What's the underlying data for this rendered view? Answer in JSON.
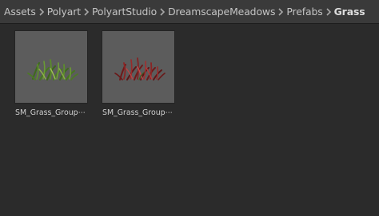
{
  "breadcrumb": {
    "items": [
      "Assets",
      "Polyart",
      "PolyartStudio",
      "DreamscapeMeadows",
      "Prefabs"
    ],
    "current": "Grass",
    "separator_icon": "chevron-right-icon"
  },
  "assets": [
    {
      "label": "SM_Grass_Group⋯",
      "thumbnail_icon": "green-grass-clump-icon",
      "color": "#4f7a2a"
    },
    {
      "label": "SM_Grass_Group⋯",
      "thumbnail_icon": "red-grass-clump-icon",
      "color": "#7a1f1f"
    }
  ],
  "colors": {
    "panel_background": "#2b2b2b",
    "breadcrumb_background": "#3a3a3a",
    "thumbnail_background": "#5c5c5c"
  }
}
